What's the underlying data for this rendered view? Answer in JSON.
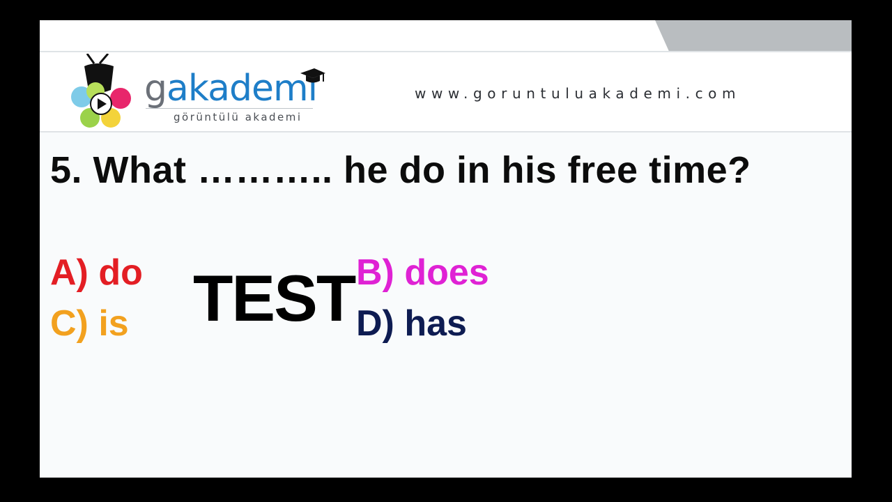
{
  "header": {
    "brand_g": "g",
    "brand_rest": "akademi",
    "brand_subtitle": "görüntülü akademi",
    "website": "www.goruntuluakademi.com"
  },
  "quiz": {
    "question": "5. What ……….. he do in his free time?",
    "options": [
      {
        "label": "A) do",
        "color": "#e31e24"
      },
      {
        "label": "B) does",
        "color": "#df22d4"
      },
      {
        "label": "C) is",
        "color": "#f2a11f"
      },
      {
        "label": "D) has",
        "color": "#0e1c52"
      }
    ]
  },
  "overlay_text": "TEST",
  "icons": {
    "logo": "tv-flower-play-icon",
    "cap": "graduation-cap-icon"
  }
}
